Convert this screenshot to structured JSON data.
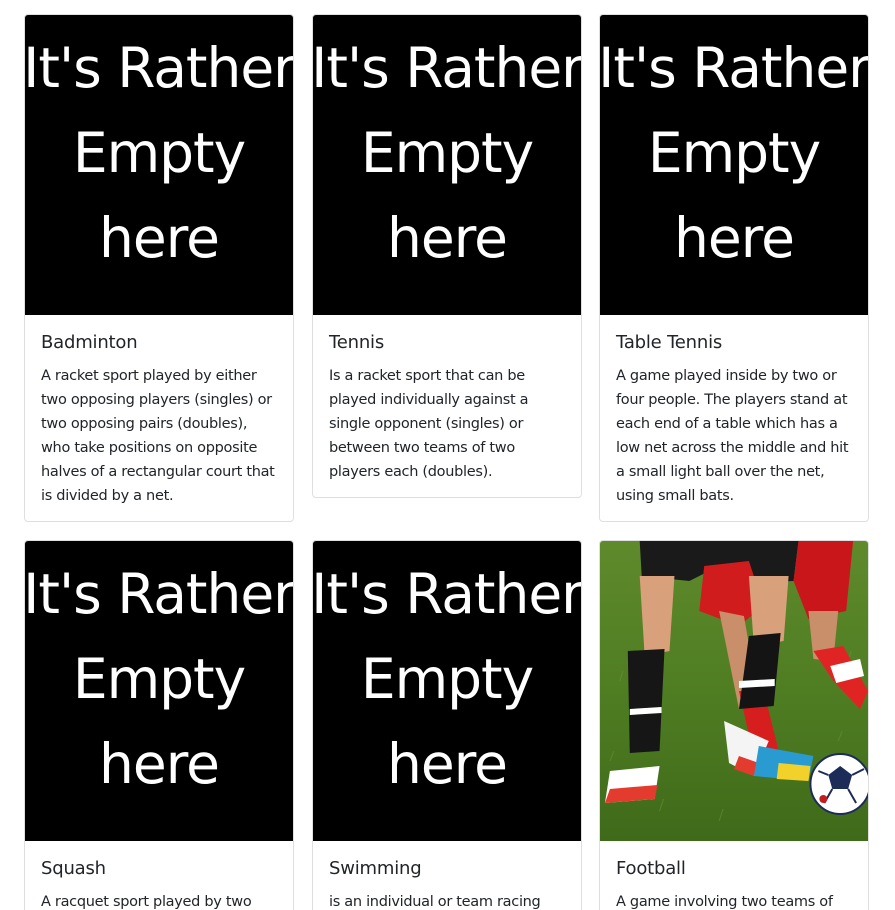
{
  "placeholder_text": "It's Rather Empty here",
  "cards": [
    {
      "title": "Badminton",
      "description": "A racket sport played by either two opposing players (singles) or two opposing pairs (doubles), who take positions on opposite halves of a rectangular court that is divided by a net."
    },
    {
      "title": "Tennis",
      "description": "Is a racket sport that can be played individually against a single opponent (singles) or between two teams of two players each (doubles)."
    },
    {
      "title": "Table Tennis",
      "description": "A game played inside by two or four people. The players stand at each end of a table which has a low net across the middle and hit a small light ball over the net, using small bats."
    },
    {
      "title": "Squash",
      "description": "A racquet sport played by two"
    },
    {
      "title": "Swimming",
      "description": "is an individual or team racing"
    },
    {
      "title": "Football",
      "description": "A game involving two teams of"
    }
  ]
}
